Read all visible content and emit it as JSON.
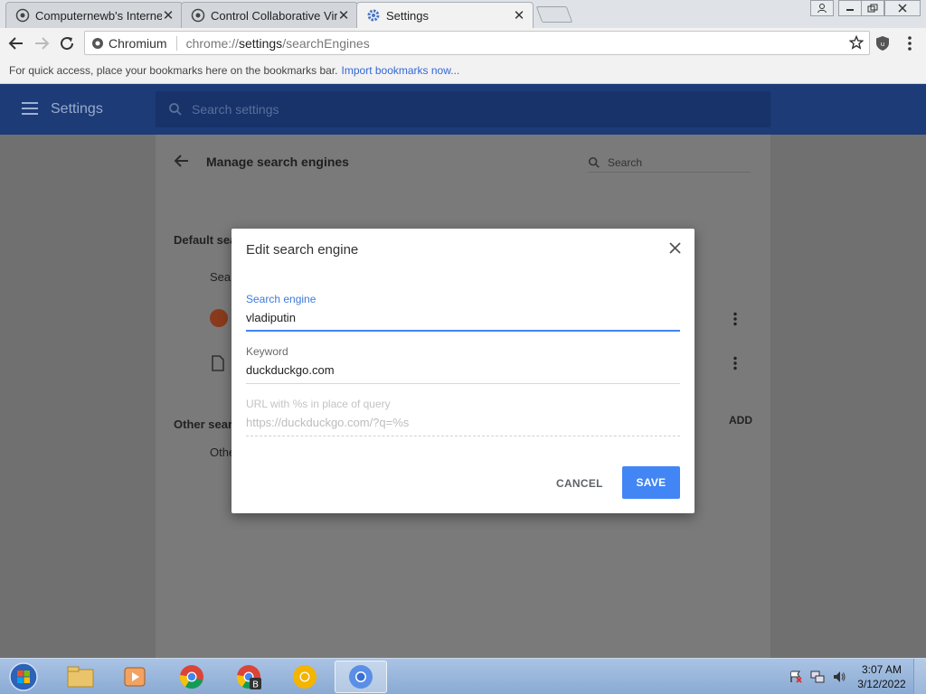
{
  "tabs": [
    {
      "title": "Computernewb's Internet"
    },
    {
      "title": "Control Collaborative Virt"
    },
    {
      "title": "Settings"
    }
  ],
  "window": {
    "restore": "❐",
    "minimize": "—",
    "close": "✕"
  },
  "omnibox": {
    "origin": "Chromium",
    "url_prefix": "chrome://",
    "url_path": "settings",
    "url_suffix": "/searchEngines"
  },
  "bookmarks": {
    "hint": "For quick access, place your bookmarks here on the bookmarks bar.",
    "import_link": "Import bookmarks now..."
  },
  "settings": {
    "title": "Settings",
    "search_placeholder": "Search settings"
  },
  "page": {
    "title": "Manage search engines",
    "search_placeholder": "Search",
    "default_section": "Default sea",
    "default_header": "Sear",
    "other_section": "Other searc",
    "other_header": "Othe",
    "add_label": "ADD"
  },
  "dialog": {
    "title": "Edit search engine",
    "fields": [
      {
        "label": "Search engine",
        "value": "vladiputin"
      },
      {
        "label": "Keyword",
        "value": "duckduckgo.com"
      },
      {
        "label": "URL with %s in place of query",
        "value": "https://duckduckgo.com/?q=%s"
      }
    ],
    "cancel": "CANCEL",
    "save": "SAVE"
  },
  "clock": {
    "time": "3:07 AM",
    "date": "3/12/2022"
  },
  "colors": {
    "accent": "#4285f4",
    "header": "#1c3b77"
  }
}
